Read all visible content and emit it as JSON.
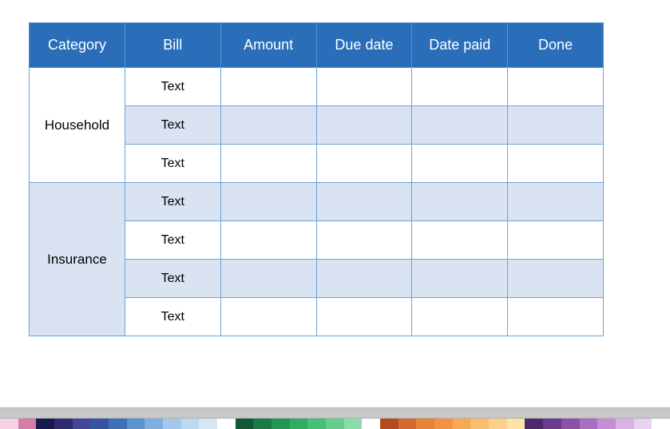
{
  "table": {
    "headers": [
      "Category",
      "Bill",
      "Amount",
      "Due date",
      "Date paid",
      "Done"
    ],
    "categories": [
      {
        "name": "Household",
        "shaded": false,
        "rows": [
          {
            "bill": "Text",
            "amount": "",
            "due_date": "",
            "date_paid": "",
            "done": "",
            "shaded": false
          },
          {
            "bill": "Text",
            "amount": "",
            "due_date": "",
            "date_paid": "",
            "done": "",
            "shaded": true
          },
          {
            "bill": "Text",
            "amount": "",
            "due_date": "",
            "date_paid": "",
            "done": "",
            "shaded": false
          }
        ]
      },
      {
        "name": "Insurance",
        "shaded": true,
        "rows": [
          {
            "bill": "Text",
            "amount": "",
            "due_date": "",
            "date_paid": "",
            "done": "",
            "shaded": true
          },
          {
            "bill": "Text",
            "amount": "",
            "due_date": "",
            "date_paid": "",
            "done": "",
            "shaded": false
          },
          {
            "bill": "Text",
            "amount": "",
            "due_date": "",
            "date_paid": "",
            "done": "",
            "shaded": true
          },
          {
            "bill": "Text",
            "amount": "",
            "due_date": "",
            "date_paid": "",
            "done": "",
            "shaded": false
          }
        ]
      }
    ]
  },
  "palette": [
    "#f7d2e2",
    "#d77ba9",
    "#191952",
    "#2e2c6c",
    "#45469a",
    "#3554a4",
    "#3f6fb7",
    "#5a93ce",
    "#7dafe0",
    "#a4c8eb",
    "#bdd9f2",
    "#d5e6f7",
    "#ffffff",
    "#0f5a34",
    "#1a7a45",
    "#229654",
    "#2fae63",
    "#44c077",
    "#63ce8f",
    "#8adca9",
    "#ffffff",
    "#b64a1f",
    "#d46a2e",
    "#e88237",
    "#f2943f",
    "#f7a955",
    "#fabc6e",
    "#fcd089",
    "#fde4a4",
    "#4a2a6c",
    "#6a3a8e",
    "#8b50a9",
    "#a86fbf",
    "#c290d2",
    "#d9b3e2",
    "#e9d1ef",
    "#ffffff"
  ]
}
